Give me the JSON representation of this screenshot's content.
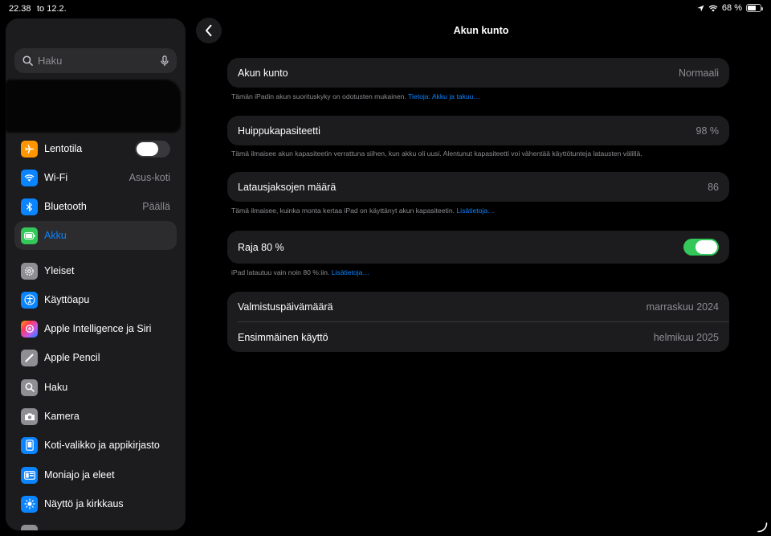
{
  "status_bar": {
    "time": "22.38",
    "date": "to 12.2.",
    "battery_percent": "68 %",
    "battery_level": 0.68
  },
  "sidebar": {
    "search_placeholder": "Haku",
    "items": [
      {
        "label": "Lentotila",
        "icon": "airplane-icon",
        "color": "#ff9500",
        "toggle": "off"
      },
      {
        "label": "Wi-Fi",
        "icon": "wifi-icon",
        "color": "#0a84ff",
        "value": "Asus-koti"
      },
      {
        "label": "Bluetooth",
        "icon": "bluetooth-icon",
        "color": "#0a84ff",
        "value": "Päällä"
      },
      {
        "label": "Akku",
        "icon": "battery-icon",
        "color": "#34c759",
        "selected": true
      },
      {
        "label": "Yleiset",
        "icon": "gear-icon",
        "color": "#8e8e93"
      },
      {
        "label": "Käyttöapu",
        "icon": "accessibility-icon",
        "color": "#0a84ff"
      },
      {
        "label": "Apple Intelligence ja Siri",
        "icon": "siri-icon",
        "color": "#ff6482"
      },
      {
        "label": "Apple Pencil",
        "icon": "pencil-icon",
        "color": "#8e8e93"
      },
      {
        "label": "Haku",
        "icon": "search-icon",
        "color": "#8e8e93"
      },
      {
        "label": "Kamera",
        "icon": "camera-icon",
        "color": "#8e8e93"
      },
      {
        "label": "Koti-valikko ja appikirjasto",
        "icon": "home-screen-icon",
        "color": "#0a84ff"
      },
      {
        "label": "Moniajo ja eleet",
        "icon": "multitasking-icon",
        "color": "#0a84ff"
      },
      {
        "label": "Näyttö ja kirkkaus",
        "icon": "brightness-icon",
        "color": "#0a84ff"
      }
    ]
  },
  "main": {
    "title": "Akun kunto",
    "health": {
      "label": "Akun kunto",
      "value": "Normaali",
      "note": "Tämän iPadin akun suorituskyky on odotusten mukainen.",
      "note_link": "Tietoja: Akku ja takuu…"
    },
    "capacity": {
      "label": "Huippukapasiteetti",
      "value": "98 %",
      "note": "Tämä ilmaisee akun kapasiteetin verrattuna siihen, kun akku oli uusi. Alentunut kapasiteetti voi vähentää käyttötunteja latausten välillä."
    },
    "cycles": {
      "label": "Latausjaksojen määrä",
      "value": "86",
      "note": "Tämä ilmaisee, kuinka monta kertaa iPad on käyttänyt akun kapasiteetin.",
      "note_link": "Lisätietoja…"
    },
    "limit": {
      "label": "Raja 80 %",
      "toggle": "on",
      "note": "iPad latautuu vain noin 80 %:iin.",
      "note_link": "Lisätietoja…"
    },
    "dates": {
      "manufacture_label": "Valmistuspäivämäärä",
      "manufacture_value": "marraskuu 2024",
      "first_use_label": "Ensimmäinen käyttö",
      "first_use_value": "helmikuu 2025"
    }
  }
}
